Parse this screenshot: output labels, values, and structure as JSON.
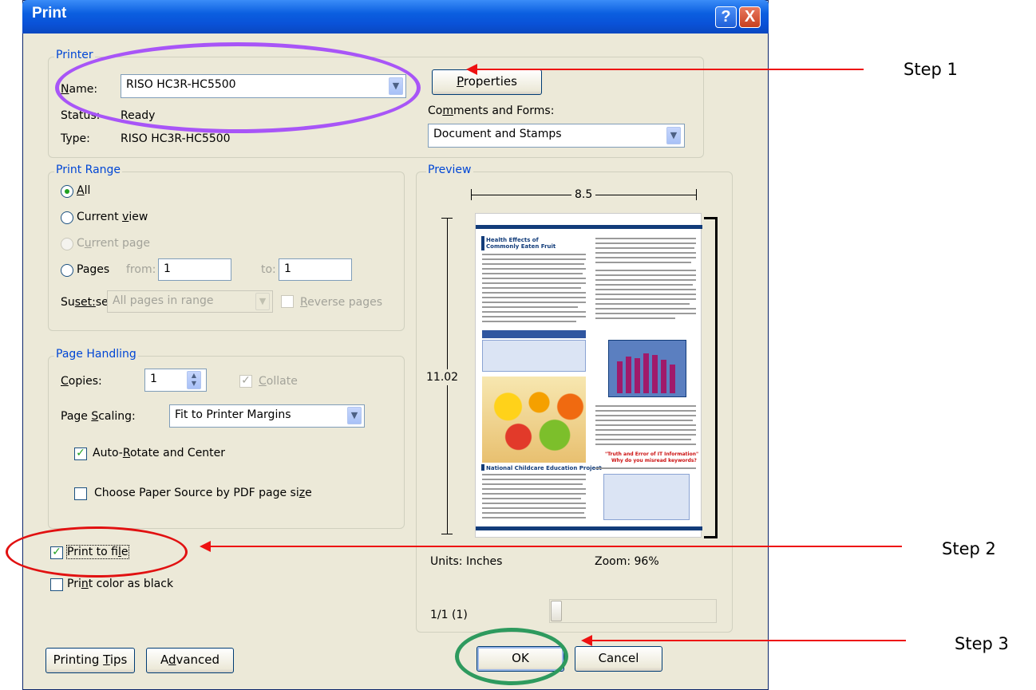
{
  "window": {
    "title": "Print"
  },
  "title_buttons": {
    "help": "?",
    "close": "X"
  },
  "printer": {
    "legend": "Printer",
    "name_label_prefix": "N",
    "name_label_rest": "ame:",
    "name_value": "RISO HC3R-HC5500",
    "status_label": "Status:",
    "status_value": "Ready",
    "type_label": "Type:",
    "type_value": "RISO HC3R-HC5500",
    "properties_prefix": "P",
    "properties_rest": "roperties",
    "comments_label_a": "Co",
    "comments_label_u": "m",
    "comments_label_b": "ments and Forms:",
    "comments_value": "Document and Stamps"
  },
  "print_range": {
    "legend": "Print Range",
    "all_u": "A",
    "all_rest": "ll",
    "current_view_a": "Current ",
    "current_view_u": "v",
    "current_view_b": "iew",
    "current_page_a": "C",
    "current_page_u": "u",
    "current_page_b": "rrent page",
    "pages_label": "Pages",
    "from_label": "from:",
    "from_value": "1",
    "to_label": "to:",
    "to_value": "1",
    "subset_a": "Su",
    "subset_u": "b",
    "subset_b": "set:",
    "subset_value": "All pages in range",
    "reverse_u": "R",
    "reverse_rest": "everse pages"
  },
  "page_handling": {
    "legend": "Page Handling",
    "copies_u": "C",
    "copies_rest": "opies:",
    "copies_value": "1",
    "collate_u": "C",
    "collate_rest": "ollate",
    "scaling_a": "Page ",
    "scaling_u": "S",
    "scaling_b": "caling:",
    "scaling_value": "Fit to Printer Margins",
    "autorotate_a": "Auto-",
    "autorotate_u": "R",
    "autorotate_b": "otate and Center",
    "paper_source_a": "Choose Paper Source by PDF page si",
    "paper_source_u": "z",
    "paper_source_b": "e"
  },
  "options": {
    "print_to_file_a": "Print to fi",
    "print_to_file_u": "l",
    "print_to_file_b": "e",
    "print_color_a": "Pri",
    "print_color_u": "n",
    "print_color_b": "t color as black"
  },
  "preview": {
    "legend": "Preview",
    "width": "8.5",
    "height": "11.02",
    "units": "Units: Inches",
    "zoom": "Zoom:  96%",
    "page_indicator": "1/1 (1)",
    "doc": {
      "heading1": "Health Effects of",
      "heading2": "Commonly Eaten Fruit",
      "heading3": "National Childcare Education Project",
      "red1": "\"Truth and Error of IT Information\"",
      "red2": "Why do you misread keywords?"
    }
  },
  "buttons": {
    "printing_tips_a": "Printing ",
    "printing_tips_u": "T",
    "printing_tips_b": "ips",
    "advanced_a": "A",
    "advanced_u": "d",
    "advanced_b": "vanced",
    "ok": "OK",
    "cancel": "Cancel"
  },
  "annotations": {
    "step1": "Step 1",
    "step2": "Step 2",
    "step3": "Step 3",
    "arrow_color": "#e11111",
    "purple": "#a855f7",
    "red_circle": "#e11111",
    "green": "#2e9a5e"
  }
}
